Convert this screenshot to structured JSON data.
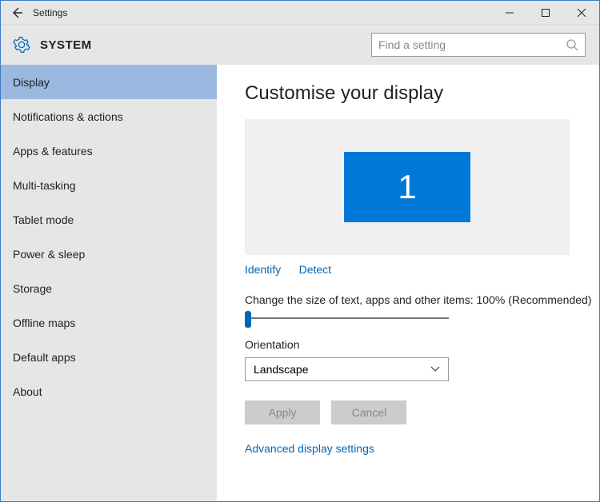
{
  "titlebar": {
    "title": "Settings"
  },
  "header": {
    "title": "SYSTEM",
    "search_placeholder": "Find a setting"
  },
  "sidebar": {
    "items": [
      {
        "label": "Display",
        "active": true
      },
      {
        "label": "Notifications & actions"
      },
      {
        "label": "Apps & features"
      },
      {
        "label": "Multi-tasking"
      },
      {
        "label": "Tablet mode"
      },
      {
        "label": "Power & sleep"
      },
      {
        "label": "Storage"
      },
      {
        "label": "Offline maps"
      },
      {
        "label": "Default apps"
      },
      {
        "label": "About"
      }
    ]
  },
  "main": {
    "heading": "Customise your display",
    "monitor_number": "1",
    "identify": "Identify",
    "detect": "Detect",
    "scale_label": "Change the size of text, apps and other items: 100% (Recommended)",
    "orientation_label": "Orientation",
    "orientation_value": "Landscape",
    "apply": "Apply",
    "cancel": "Cancel",
    "advanced": "Advanced display settings"
  }
}
